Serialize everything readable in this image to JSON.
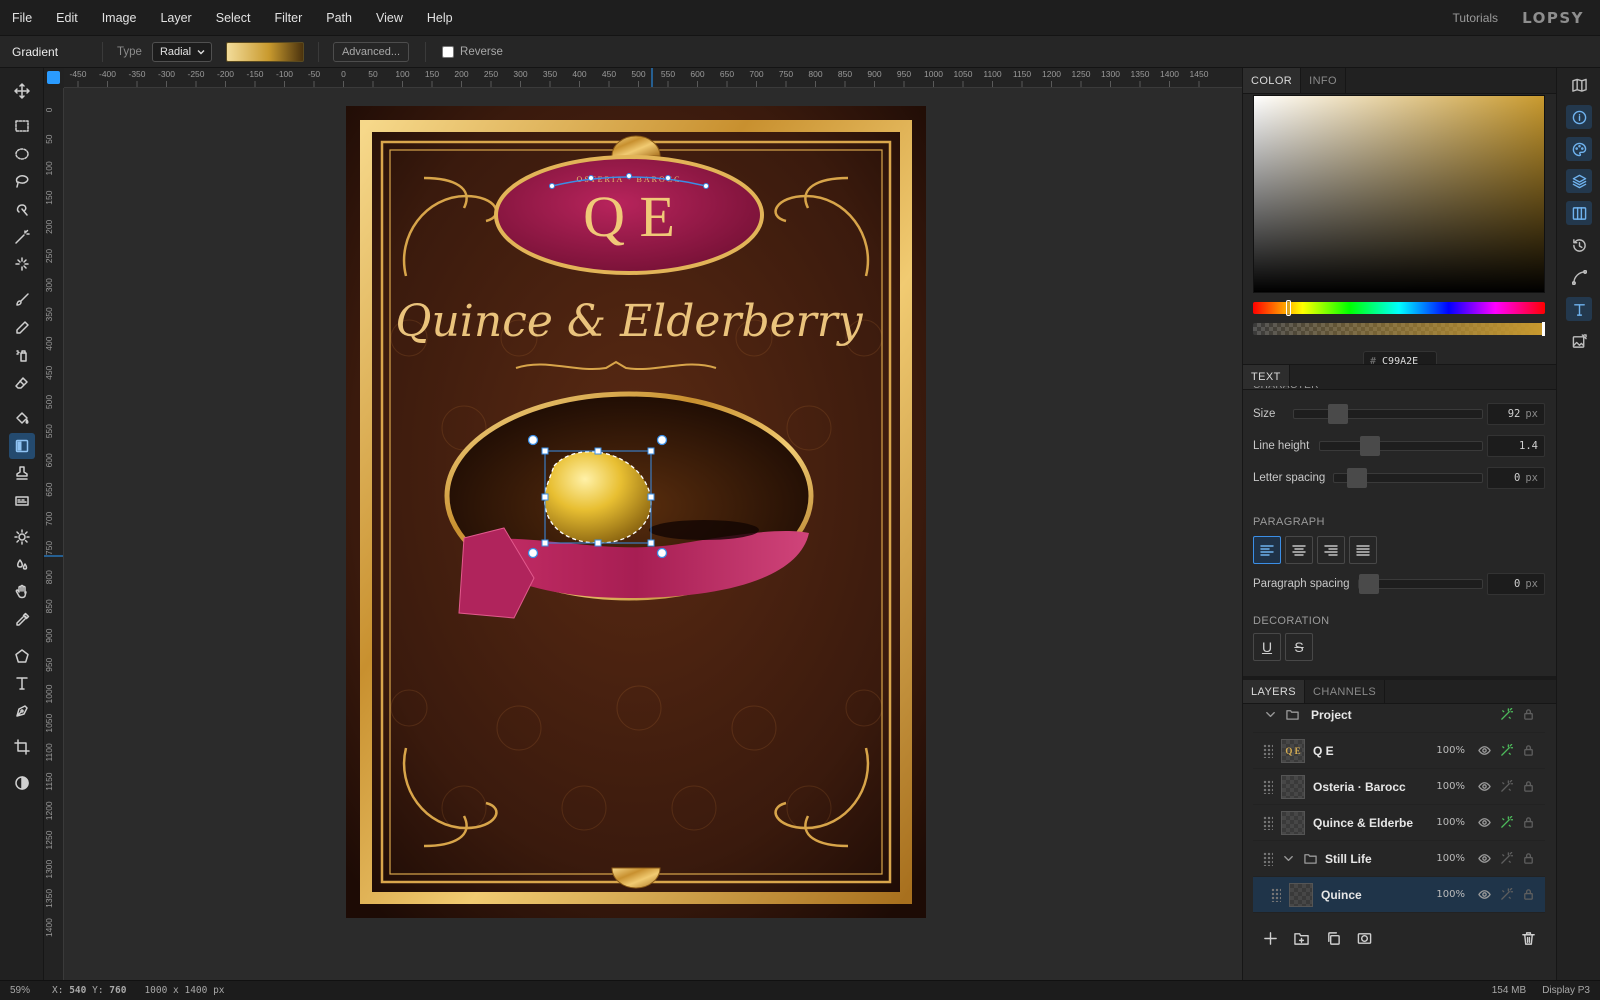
{
  "menu": [
    "File",
    "Edit",
    "Image",
    "Layer",
    "Select",
    "Filter",
    "Path",
    "View",
    "Help"
  ],
  "menu_right": {
    "tutorials": "Tutorials",
    "brand": "LOPSY"
  },
  "options": {
    "tool": "Gradient",
    "type_label": "Type",
    "type_value": "Radial",
    "advanced": "Advanced...",
    "reverse_label": "Reverse",
    "reverse_checked": false,
    "gradient_colors": [
      "#f2dc9a",
      "#c99a2e",
      "#4b330e"
    ]
  },
  "tools": [
    "move",
    "rect-select",
    "ellipse-select",
    "lasso",
    "quick-select",
    "magic-wand",
    "sparkle",
    "brush",
    "pencil",
    "spray",
    "eraser",
    "fill",
    "gradient",
    "stamp",
    "pattern",
    "dodge",
    "blur",
    "hand",
    "eyedropper",
    "polygon",
    "text",
    "pen",
    "crop",
    "contrast"
  ],
  "active_tool": "gradient",
  "rulers": {
    "h": [
      "-450",
      "-400",
      "-350",
      "-300",
      "-250",
      "-200",
      "-150",
      "-100",
      "-50",
      "0",
      "50",
      "100",
      "150",
      "200",
      "250",
      "300",
      "350",
      "400",
      "450",
      "500",
      "550",
      "600",
      "650",
      "700",
      "750",
      "800",
      "850",
      "900",
      "950",
      "1000",
      "1050",
      "1100",
      "1150",
      "1200",
      "1250",
      "1300",
      "1350",
      "1400",
      "1450"
    ],
    "v": [
      "0",
      "50",
      "100",
      "150",
      "200",
      "250",
      "300",
      "350",
      "400",
      "450",
      "500",
      "550",
      "600",
      "650",
      "700",
      "750",
      "800",
      "850",
      "900",
      "950",
      "1000",
      "1050",
      "1100",
      "1150",
      "1200",
      "1250",
      "1300",
      "1350",
      "1400"
    ]
  },
  "poster": {
    "monogram": "Q E",
    "arc_text": "OSTERIA · BAROCC",
    "title": "Quince & Elderberry",
    "bg": "#3a1a0d",
    "gold": "#e7b65c",
    "berry": "#8e1745"
  },
  "status": {
    "zoom": "59%",
    "x": "540",
    "y": "760",
    "x_label": "X:",
    "y_label": "Y:",
    "doc_size": "1000 x 1400 px",
    "memory": "154 MB",
    "profile": "Display P3"
  },
  "color_panel": {
    "tabs": [
      "COLOR",
      "INFO"
    ],
    "active": "COLOR",
    "hex_prefix": "#",
    "hex": "C99A2E",
    "color": "#c99a2e"
  },
  "text_panel": {
    "tab": "TEXT",
    "cut_heading": "CHARACTER",
    "size": {
      "label": "Size",
      "value": "92",
      "unit": "px",
      "level": 0.2
    },
    "line_height": {
      "label": "Line height",
      "value": "1.4",
      "level": 0.28
    },
    "letter_spacing": {
      "label": "Letter spacing",
      "value": "0",
      "unit": "px",
      "level": 0.1
    },
    "paragraph_title": "PARAGRAPH",
    "paragraph_spacing": {
      "label": "Paragraph spacing",
      "value": "0",
      "unit": "px",
      "level": 0.0
    },
    "decoration_title": "DECORATION",
    "underline": "U",
    "strike": "S",
    "alignments": [
      "left",
      "center",
      "right",
      "justify"
    ],
    "active_alignment": "left"
  },
  "layers_panel": {
    "tabs": [
      "LAYERS",
      "CHANNELS"
    ],
    "active": "LAYERS",
    "layers": [
      {
        "name": "Project",
        "type": "group",
        "opacity": "",
        "fx": true,
        "indent": 0
      },
      {
        "name": "Q E",
        "type": "text",
        "opacity": "100%",
        "fx": true,
        "thumb": "Q E",
        "indent": 1
      },
      {
        "name": "Osteria · Barocc",
        "type": "text",
        "opacity": "100%",
        "fx": false,
        "thumb": "",
        "indent": 1
      },
      {
        "name": "Quince & Elderbe",
        "type": "text",
        "opacity": "100%",
        "fx": true,
        "thumb": "",
        "indent": 1
      },
      {
        "name": "Still Life",
        "type": "group",
        "opacity": "100%",
        "fx": false,
        "indent": 1
      },
      {
        "name": "Quince",
        "type": "image",
        "opacity": "100%",
        "fx": false,
        "thumb": "",
        "indent": 2,
        "selected": true
      }
    ]
  },
  "side_panel_icons": [
    "map",
    "info",
    "palette",
    "layers",
    "columns",
    "history",
    "curve",
    "text",
    "image-edit"
  ],
  "side_active": [
    "info",
    "palette",
    "layers",
    "columns",
    "text"
  ]
}
